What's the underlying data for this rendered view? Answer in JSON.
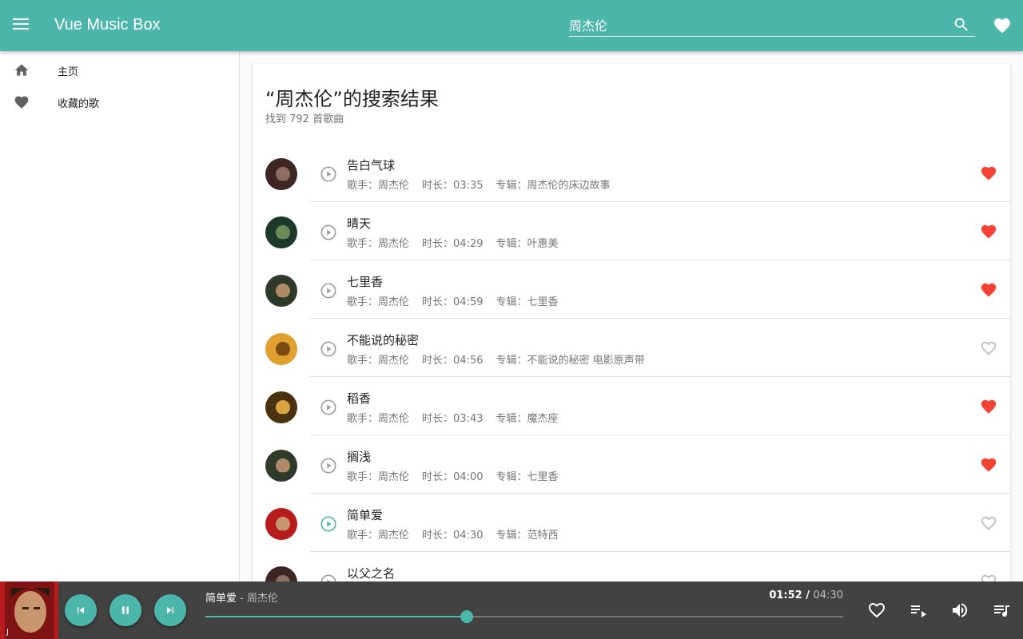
{
  "header": {
    "app_title": "Vue Music Box",
    "search_value": "周杰伦"
  },
  "sidebar": {
    "items": [
      {
        "label": "主页",
        "icon": "home-icon"
      },
      {
        "label": "收藏的歌",
        "icon": "heart-icon"
      }
    ]
  },
  "results": {
    "title": "“周杰伦”的搜索结果",
    "count_text": "找到 792 首歌曲"
  },
  "songs": [
    {
      "name": "告白气球",
      "artist": "歌手：周杰伦",
      "duration": "时长：03:35",
      "album": "专辑：周杰伦的床边故事",
      "favorited": true,
      "playing": false
    },
    {
      "name": "晴天",
      "artist": "歌手：周杰伦",
      "duration": "时长：04:29",
      "album": "专辑：叶惠美",
      "favorited": true,
      "playing": false
    },
    {
      "name": "七里香",
      "artist": "歌手：周杰伦",
      "duration": "时长：04:59",
      "album": "专辑：七里香",
      "favorited": true,
      "playing": false
    },
    {
      "name": "不能说的秘密",
      "artist": "歌手：周杰伦",
      "duration": "时长：04:56",
      "album": "专辑：不能说的秘密 电影原声带",
      "favorited": false,
      "playing": false
    },
    {
      "name": "稻香",
      "artist": "歌手：周杰伦",
      "duration": "时长：03:43",
      "album": "专辑：魔杰座",
      "favorited": true,
      "playing": false
    },
    {
      "name": "搁浅",
      "artist": "歌手：周杰伦",
      "duration": "时长：04:00",
      "album": "专辑：七里香",
      "favorited": true,
      "playing": false
    },
    {
      "name": "简单爱",
      "artist": "歌手：周杰伦",
      "duration": "时长：04:30",
      "album": "专辑：范特西",
      "favorited": false,
      "playing": true
    },
    {
      "name": "以父之名",
      "artist": "",
      "duration": "",
      "album": "",
      "favorited": false,
      "playing": false
    }
  ],
  "player": {
    "song": "简单爱",
    "separator": " - ",
    "artist": "周杰伦",
    "current_time": "01:52",
    "time_sep": " / ",
    "total_time": "04:30",
    "progress": 0.41
  },
  "colors": {
    "accent": "#4db6ac",
    "favorite": "#f44336",
    "player_bg": "#424242"
  }
}
